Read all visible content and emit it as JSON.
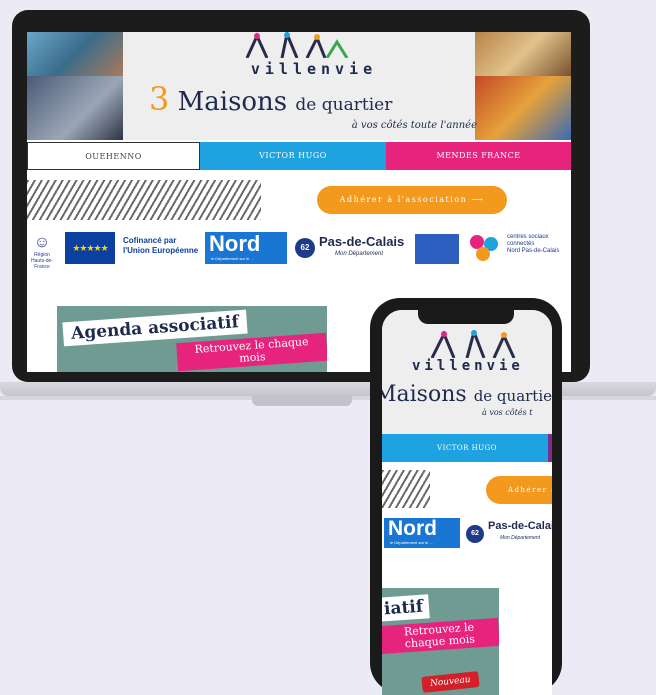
{
  "site": {
    "brand": "villenvie",
    "title_number": "3",
    "title_main": "Maisons",
    "title_rest": "de quartier",
    "tagline": "à vos côtés toute l'année"
  },
  "tabs": [
    {
      "label": "OUEHENNO",
      "color": "#ffffff"
    },
    {
      "label": "VICTOR HUGO",
      "color": "#1fa3e0"
    },
    {
      "label": "MENDES FRANCE",
      "color": "#e6247e"
    }
  ],
  "cta": {
    "label": "Adhérer à l'association ⟶",
    "color": "#f39a1e"
  },
  "partners": {
    "hdf": "Région Hauts-de-France",
    "eu_label": "Cofinancé par l'Union Européenne",
    "nord": "Nord",
    "nord_sub": "le Département sur le ...",
    "pdc_num": "62",
    "pdc": "Pas-de-Calais",
    "pdc_sub": "Mon Département",
    "centres": "centres sociaux connectés",
    "centres_sub": "Nord Pas-de-Calais"
  },
  "agenda": {
    "title": "Agenda associatif",
    "subtitle": "Retrouvez le chaque mois"
  },
  "mobile": {
    "brand": "villenvie",
    "title": "Maisons",
    "title_rest": "de quartie",
    "tagline": "à vos côtés t",
    "tab": "VICTOR HUGO",
    "cta": "Adhérer à",
    "agenda_title": "iatif",
    "agenda_sub": "Retrouvez le chaque mois",
    "badge": "Nouveau"
  }
}
